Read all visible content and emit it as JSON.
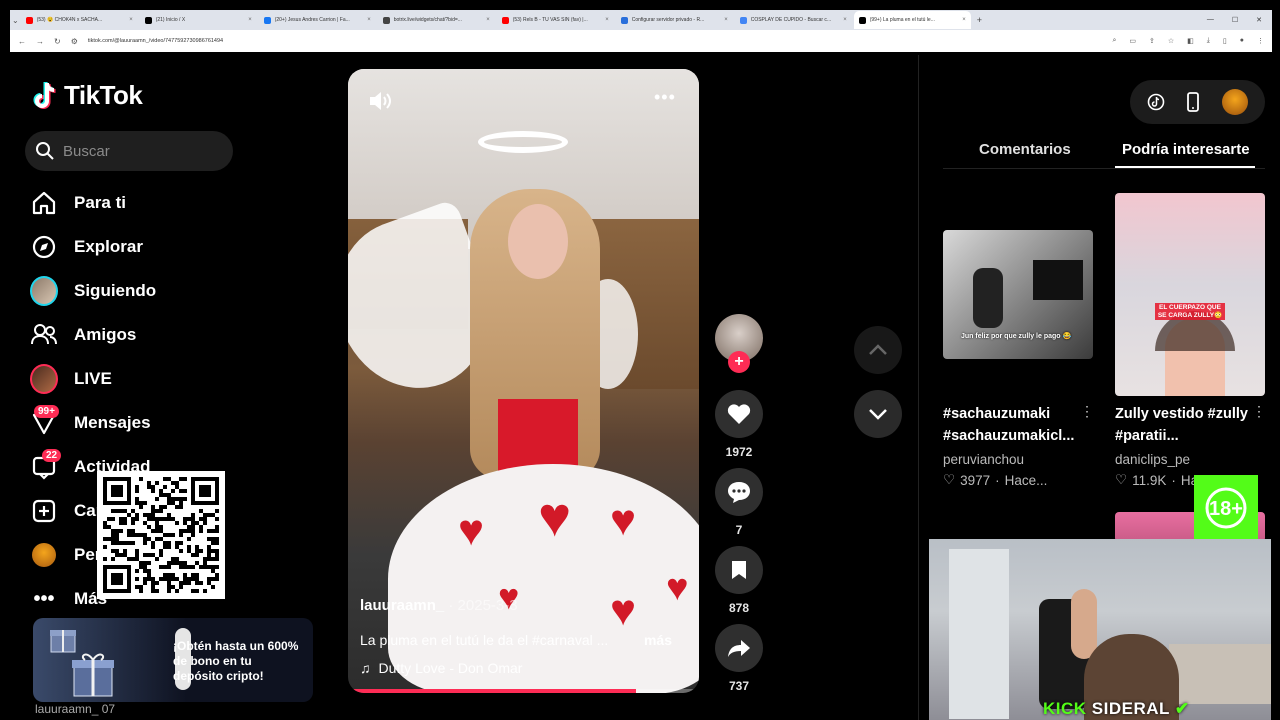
{
  "browser": {
    "tabs": [
      {
        "title": "(53) 😵 CHOK4N x SACHA...",
        "color": "#ff0000",
        "active": false
      },
      {
        "title": "(21) Inicio / X",
        "color": "#000000",
        "active": false
      },
      {
        "title": "(20+) Jesus Andres Carrion | Fa...",
        "color": "#1877f2",
        "active": false
      },
      {
        "title": "botrix.live/widgets/chat/?bid=...",
        "color": "#444444",
        "active": false
      },
      {
        "title": "(53) Rels B - TU VAS SIN (fav) |...",
        "color": "#ff0000",
        "active": false
      },
      {
        "title": "Configurar servidor privado - R...",
        "color": "#2a6fdb",
        "active": false
      },
      {
        "title": "COSPLAY DE CUPIDO - Buscar c...",
        "color": "#4285f4",
        "active": false
      },
      {
        "title": "(99+) La pluma en el tutú le...",
        "color": "#000000",
        "active": true
      }
    ],
    "new_tab": "+",
    "url": "tiktok.com/@lauuraamn_/video/7477592730986761494"
  },
  "nav": {
    "logo_text": "TikTok",
    "search_placeholder": "Buscar",
    "items": [
      {
        "label": "Para ti"
      },
      {
        "label": "Explorar"
      },
      {
        "label": "Siguiendo"
      },
      {
        "label": "Amigos"
      },
      {
        "label": "LIVE"
      },
      {
        "label": "Mensajes",
        "badge": "99+"
      },
      {
        "label": "Actividad",
        "badge": "22"
      },
      {
        "label": "Cargar"
      },
      {
        "label": "Perfil"
      },
      {
        "label": "Más"
      }
    ]
  },
  "promo": {
    "text": "¡Obtén hasta un 600% de bono en tu depósito cripto!",
    "under": "lauuraamn_ 07"
  },
  "video": {
    "username": "lauuraamn_",
    "date": "2025-3-3",
    "description": "La pluma en el tutú le da el #carnaval ...",
    "more": "más",
    "music": "Dutty Love - Don Omar",
    "progress": 0.82
  },
  "actions": {
    "likes": "1972",
    "comments": "7",
    "saves": "878",
    "shares": "737"
  },
  "right_panel": {
    "tabs": [
      "Comentarios",
      "Podría interesarte"
    ],
    "active_tab": 1,
    "cards": [
      {
        "title": "#sachauzumaki #sachauzumakicl...",
        "author": "peruvianchou",
        "likes": "3977",
        "time": "Hace...",
        "overlay": "Jun feliz por que zully le pago 😂"
      },
      {
        "title": "Zully vestido #zully #paratii...",
        "author": "daniclips_pe",
        "likes": "11.9K",
        "time": "Ha",
        "overlay": "EL CUERPAZO QUE SE CARGA ZULLY😳"
      }
    ]
  },
  "stream_overlay": {
    "kick_label": "KICK",
    "channel": "SIDERAL",
    "age_badge": "18+"
  },
  "colors": {
    "accent": "#fe2c55",
    "cyan": "#25f4ee",
    "kick_green": "#53fc18"
  }
}
